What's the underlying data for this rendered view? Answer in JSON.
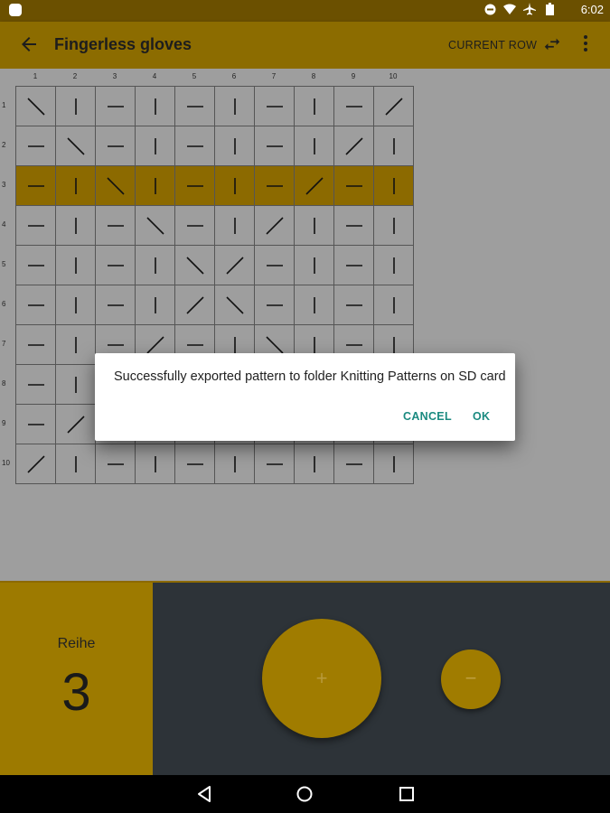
{
  "status_bar": {
    "time": "6:02",
    "icons": [
      "android-icon",
      "do-not-disturb-icon",
      "wifi-icon",
      "airplane-icon",
      "battery-icon"
    ]
  },
  "app_bar": {
    "title": "Fingerless gloves",
    "action_label": "CURRENT ROW",
    "icons": [
      "back-arrow-icon",
      "swap-icon",
      "more-vert-icon"
    ]
  },
  "pattern": {
    "columns": [
      "1",
      "2",
      "3",
      "4",
      "5",
      "6",
      "7",
      "8",
      "9",
      "10"
    ],
    "rows": [
      "1",
      "2",
      "3",
      "4",
      "5",
      "6",
      "7",
      "8",
      "9",
      "10"
    ],
    "current_row": 3,
    "cells": [
      [
        "\\",
        "|",
        "-",
        "|",
        "-",
        "|",
        "-",
        "|",
        "-",
        "/"
      ],
      [
        "-",
        "\\",
        "-",
        "|",
        "-",
        "|",
        "-",
        "|",
        "/",
        "|"
      ],
      [
        "-",
        "|",
        "\\",
        "|",
        "-",
        "|",
        "-",
        "/",
        "-",
        "|"
      ],
      [
        "-",
        "|",
        "-",
        "\\",
        "-",
        "|",
        "/",
        "|",
        "-",
        "|"
      ],
      [
        "-",
        "|",
        "-",
        "|",
        "\\",
        "/",
        "-",
        "|",
        "-",
        "|"
      ],
      [
        "-",
        "|",
        "-",
        "|",
        "/",
        "\\",
        "-",
        "|",
        "-",
        "|"
      ],
      [
        "-",
        "|",
        "-",
        "/",
        "-",
        "|",
        "\\",
        "|",
        "-",
        "|"
      ],
      [
        "-",
        "|",
        "/",
        "|",
        "-",
        "|",
        "-",
        "\\",
        "|",
        "|"
      ],
      [
        "-",
        "/",
        "-",
        "|",
        "-",
        "|",
        "-",
        "|",
        "\\",
        "|"
      ],
      [
        "/",
        "|",
        "-",
        "|",
        "-",
        "|",
        "-",
        "|",
        "-",
        "|"
      ]
    ],
    "colors": {
      "grid_bg": "#9e9e9e",
      "current_row": "#8c6a00",
      "line": "#555555"
    }
  },
  "counter": {
    "label": "Reihe",
    "value": "3",
    "plus_symbol": "+",
    "minus_symbol": "−"
  },
  "dialog": {
    "message": "Successfully exported pattern to folder Knitting Patterns on SD card",
    "cancel_label": "CANCEL",
    "ok_label": "OK"
  },
  "nav_bar": {
    "icons": [
      "back-triangle-icon",
      "home-circle-icon",
      "recents-square-icon"
    ]
  },
  "colors": {
    "accent": "#8c6c00",
    "dialog_button": "#1a8a80",
    "controls_bg": "#2d3338"
  }
}
